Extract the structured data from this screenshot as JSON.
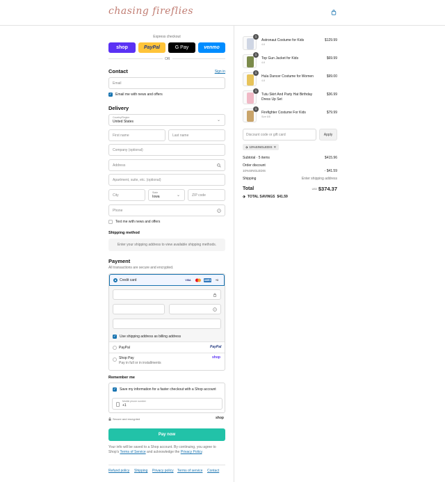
{
  "header": {
    "logo": "chasing fireflies",
    "cart_icon": "shopping-bag-icon"
  },
  "express": {
    "title": "Express checkout",
    "buttons": {
      "shop": "shop",
      "paypal": "PayPal",
      "gpay": "G Pay",
      "venmo": "venmo"
    },
    "or": "OR"
  },
  "contact": {
    "title": "Contact",
    "signin": "Sign in",
    "email_placeholder": "Email",
    "email_news": "Email me with news and offers"
  },
  "delivery": {
    "title": "Delivery",
    "country_label": "Country/Region",
    "country_value": "United States",
    "first_name": "First name",
    "last_name": "Last name",
    "company": "Company (optional)",
    "address": "Address",
    "apartment": "Apartment, suite, etc. (optional)",
    "city": "City",
    "state_label": "State",
    "state_value": "Iowa",
    "zip": "ZIP code",
    "phone": "Phone",
    "text_news": "Text me with news and offers"
  },
  "shipping": {
    "title": "Shipping method",
    "message": "Enter your shipping address to view available shipping methods."
  },
  "payment": {
    "title": "Payment",
    "subtitle": "All transactions are secure and encrypted.",
    "credit_card": "Credit card",
    "card_logos": [
      "VISA",
      "MC",
      "AMEX",
      "+3"
    ],
    "billing_same": "Use shipping address as billing address",
    "paypal": "PayPal",
    "paypal_logo": "PayPal",
    "shoppay": "Shop Pay",
    "shoppay_sub": "Pay in full or in installments",
    "shoppay_logo": "shop"
  },
  "remember": {
    "title": "Remember me",
    "save_info": "Save my information for a faster checkout with a Shop account",
    "mobile_label": "Mobile phone number",
    "mobile_value": "+1",
    "secure": "Secure and encrypted",
    "shop_logo": "shop"
  },
  "pay_now": "Pay now",
  "legal": {
    "text1": "Your info will be saved to a Shop account. By continuing, you agree to Shop's ",
    "tos": "Terms of Service",
    "text2": " and acknowledge the ",
    "privacy": "Privacy Policy",
    "text3": "."
  },
  "footer": [
    "Refund policy",
    "Shipping",
    "Privacy policy",
    "Terms of service",
    "Contact"
  ],
  "order": {
    "items": [
      {
        "qty": "1",
        "name": "Astronaut Costume for Kids",
        "variant": "4-6",
        "price": "$129.99",
        "color": "#cfd6e4"
      },
      {
        "qty": "1",
        "name": "Top Gun Jacket for Kids",
        "variant": "4-6",
        "price": "$69.99",
        "color": "#7b8a4a"
      },
      {
        "qty": "1",
        "name": "Hula Dancer Costume for Women",
        "variant": "4-6",
        "price": "$99.00",
        "color": "#e7c35a"
      },
      {
        "qty": "1",
        "name": "Tutu Skirt And Party Hat Birthday Dress Up Set",
        "variant": "",
        "price": "$36.99",
        "color": "#f0b9c6"
      },
      {
        "qty": "1",
        "name": "Firefighter Costume For Kids",
        "variant": "Size 6/8",
        "price": "$79.99",
        "color": "#c9a46a"
      }
    ],
    "discount_placeholder": "Discount code or gift card",
    "apply": "Apply",
    "code": "10%SINGLEDIS",
    "subtotal_label": "Subtotal · 5 items",
    "subtotal_value": "$415.96",
    "order_discount_label": "Order discount",
    "order_discount_code": "10%SINGLEDIS",
    "order_discount_value": "- $41.59",
    "shipping_label": "Shipping",
    "shipping_value": "Enter shipping address",
    "total_label": "Total",
    "currency": "USD",
    "total_value": "$374.37",
    "savings_label": "TOTAL SAVINGS",
    "savings_value": "$41.59"
  }
}
